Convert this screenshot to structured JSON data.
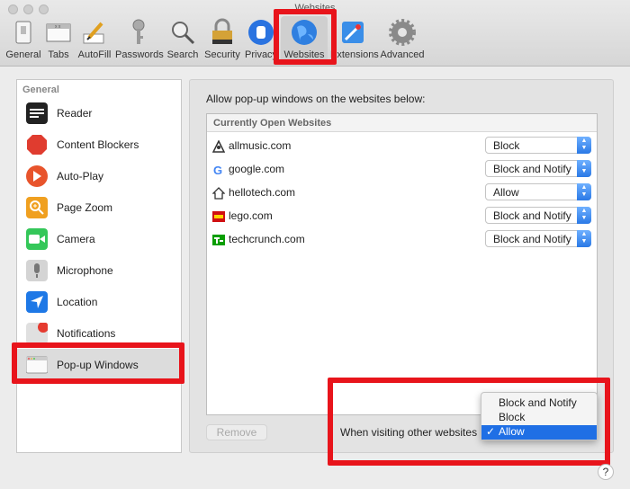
{
  "window": {
    "title": "Websites"
  },
  "toolbar": {
    "items": [
      {
        "label": "General",
        "icon": "general-switch-icon"
      },
      {
        "label": "Tabs",
        "icon": "tabs-icon"
      },
      {
        "label": "AutoFill",
        "icon": "autofill-pencil-icon"
      },
      {
        "label": "Passwords",
        "icon": "key-icon"
      },
      {
        "label": "Search",
        "icon": "magnifier-icon"
      },
      {
        "label": "Security",
        "icon": "lock-icon"
      },
      {
        "label": "Privacy",
        "icon": "hand-icon"
      },
      {
        "label": "Websites",
        "icon": "globe-icon"
      },
      {
        "label": "Extensions",
        "icon": "puzzle-icon"
      },
      {
        "label": "Advanced",
        "icon": "gear-icon"
      }
    ],
    "selected": "Websites"
  },
  "sidebar": {
    "header": "General",
    "items": [
      {
        "label": "Reader",
        "icon": "reader-icon"
      },
      {
        "label": "Content Blockers",
        "icon": "stop-sign-icon"
      },
      {
        "label": "Auto-Play",
        "icon": "play-icon"
      },
      {
        "label": "Page Zoom",
        "icon": "zoom-icon"
      },
      {
        "label": "Camera",
        "icon": "camera-icon"
      },
      {
        "label": "Microphone",
        "icon": "microphone-icon"
      },
      {
        "label": "Location",
        "icon": "location-arrow-icon"
      },
      {
        "label": "Notifications",
        "icon": "notification-icon"
      },
      {
        "label": "Pop-up Windows",
        "icon": "popup-window-icon"
      }
    ],
    "selected": "Pop-up Windows"
  },
  "main": {
    "prompt": "Allow pop-up windows on the websites below:",
    "table_header": "Currently Open Websites",
    "rows": [
      {
        "site": "allmusic.com",
        "setting": "Block"
      },
      {
        "site": "google.com",
        "setting": "Block and Notify"
      },
      {
        "site": "hellotech.com",
        "setting": "Allow"
      },
      {
        "site": "lego.com",
        "setting": "Block and Notify"
      },
      {
        "site": "techcrunch.com",
        "setting": "Block and Notify"
      }
    ],
    "remove_label": "Remove",
    "other_label": "When visiting other websites",
    "menu_options": [
      "Block and Notify",
      "Block",
      "Allow"
    ],
    "menu_selected": "Allow",
    "help": "?"
  },
  "colors": {
    "highlight": "#e8141b",
    "accent": "#1f6fe5"
  }
}
